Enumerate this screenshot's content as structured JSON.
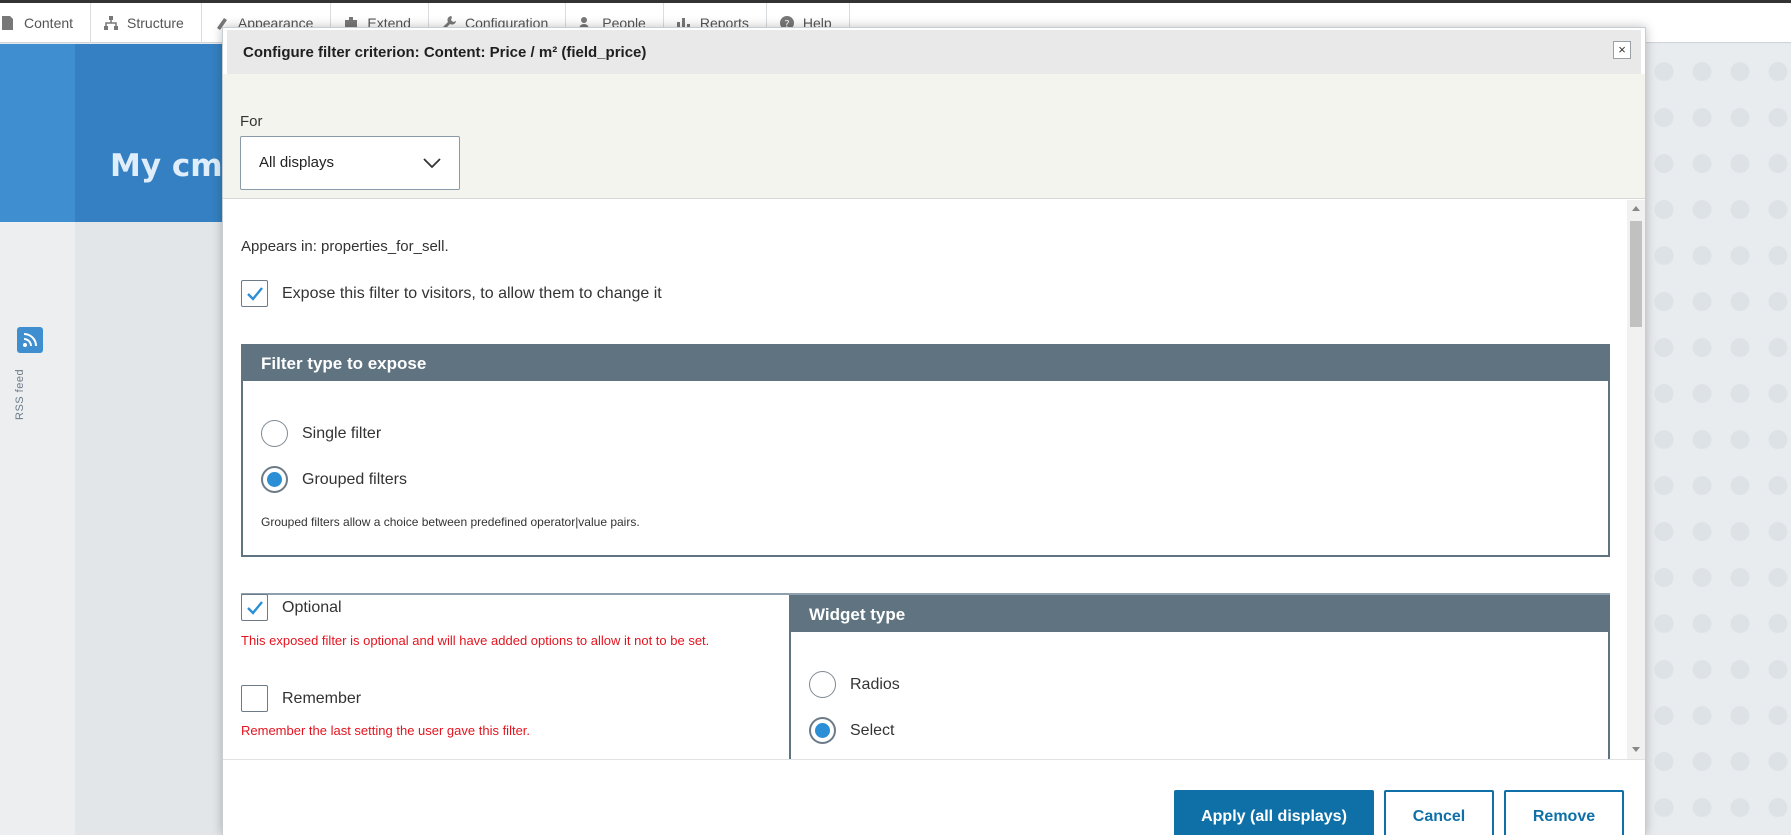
{
  "toolbar": {
    "items": [
      {
        "label": "Content",
        "icon": "content-icon"
      },
      {
        "label": "Structure",
        "icon": "structure-icon"
      },
      {
        "label": "Appearance",
        "icon": "appearance-icon"
      },
      {
        "label": "Extend",
        "icon": "extend-icon"
      },
      {
        "label": "Configuration",
        "icon": "configuration-icon"
      },
      {
        "label": "People",
        "icon": "people-icon"
      },
      {
        "label": "Reports",
        "icon": "reports-icon"
      },
      {
        "label": "Help",
        "icon": "help-icon"
      }
    ]
  },
  "background": {
    "site_title": "My cms",
    "rss_label": "RSS feed"
  },
  "dialog": {
    "title": "Configure filter criterion: Content: Price / m² (field_price)",
    "close_label": "×",
    "for_label": "For",
    "for_value": "All displays",
    "appears_in": "Appears in: properties_for_sell.",
    "expose_label": "Expose this filter to visitors, to allow them to change it",
    "expose_checked": true,
    "filter_type": {
      "legend": "Filter type to expose",
      "options": [
        {
          "label": "Single filter",
          "selected": false
        },
        {
          "label": "Grouped filters",
          "selected": true
        }
      ],
      "description": "Grouped filters allow a choice between predefined operator|value pairs."
    },
    "optional": {
      "label": "Optional",
      "checked": true,
      "description": "This exposed filter is optional and will have added options to allow it not to be set."
    },
    "remember": {
      "label": "Remember",
      "checked": false,
      "description": "Remember the last setting the user gave this filter."
    },
    "widget_type": {
      "legend": "Widget type",
      "options": [
        {
          "label": "Radios",
          "selected": false
        },
        {
          "label": "Select",
          "selected": true
        }
      ]
    },
    "buttons": {
      "apply": "Apply (all displays)",
      "cancel": "Cancel",
      "remove": "Remove"
    }
  },
  "colors": {
    "accent": "#0f70a8",
    "legend_bg": "#5f7380",
    "error_text": "#e4141f",
    "radio_fill": "#2b8fd6"
  }
}
